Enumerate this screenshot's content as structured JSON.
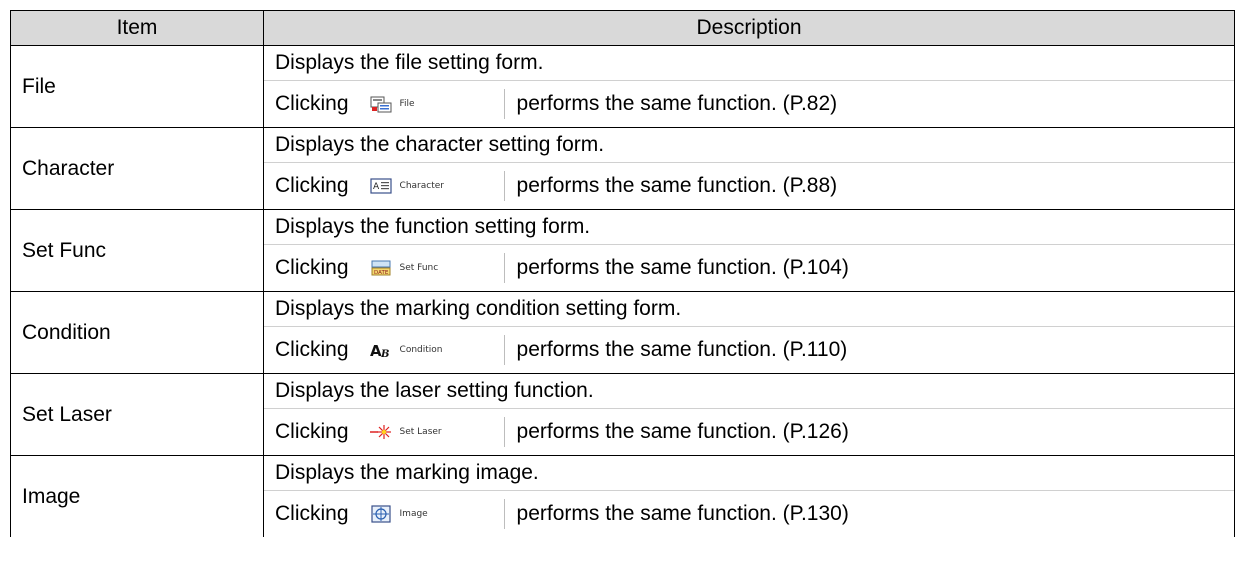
{
  "headers": {
    "item": "Item",
    "description": "Description"
  },
  "clicking_word": "Clicking",
  "rows": [
    {
      "item": "File",
      "line1": "Displays the file setting form.",
      "button_label": "File",
      "icon": "file-form-icon",
      "line2": "performs the same function. (P.82)"
    },
    {
      "item": "Character",
      "line1": "Displays the character setting form.",
      "button_label": "Character",
      "icon": "character-form-icon",
      "line2": "performs the same function. (P.88)"
    },
    {
      "item": "Set Func",
      "line1": "Displays the function setting form.",
      "button_label": "Set Func",
      "icon": "date-function-icon",
      "line2": "performs the same function. (P.104)"
    },
    {
      "item": "Condition",
      "line1": "Displays the marking condition setting form.",
      "button_label": "Condition",
      "icon": "ab-condition-icon",
      "line2": "performs the same function. (P.110)"
    },
    {
      "item": "Set Laser",
      "line1": "Displays the laser setting function.",
      "button_label": "Set Laser",
      "icon": "laser-burst-icon",
      "line2": "performs the same function. (P.126)"
    },
    {
      "item": "Image",
      "line1": "Displays the marking image.",
      "button_label": "Image",
      "icon": "image-crosshair-icon",
      "line2": "performs the same function. (P.130)"
    }
  ],
  "colors": {
    "header_bg": "#d9d9d9",
    "border": "#000000"
  }
}
